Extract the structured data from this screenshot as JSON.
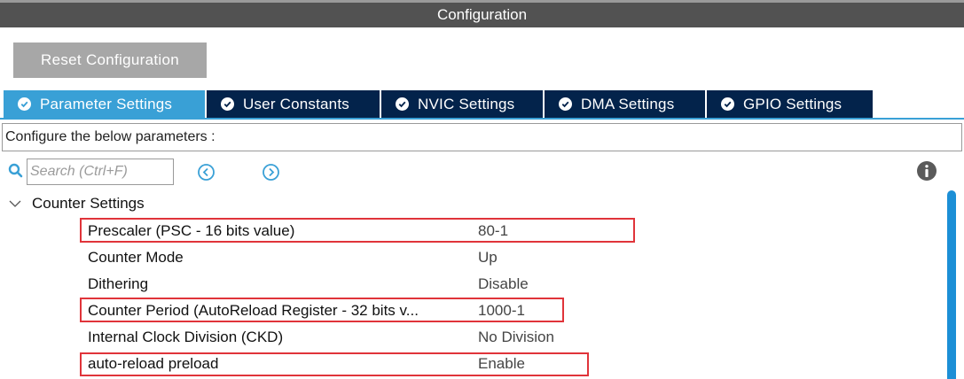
{
  "window": {
    "title": "Configuration"
  },
  "toolbar": {
    "reset_label": "Reset Configuration"
  },
  "tabs": [
    {
      "label": "Parameter Settings",
      "active": true
    },
    {
      "label": "User Constants",
      "active": false
    },
    {
      "label": "NVIC Settings",
      "active": false
    },
    {
      "label": "DMA Settings",
      "active": false
    },
    {
      "label": "GPIO Settings",
      "active": false
    }
  ],
  "configure_text": "Configure the below parameters :",
  "search": {
    "placeholder": "Search (Ctrl+F)",
    "value": ""
  },
  "group": {
    "label": "Counter Settings",
    "rows": [
      {
        "name": "Prescaler (PSC - 16 bits value)",
        "value": "80-1",
        "highlighted": true
      },
      {
        "name": "Counter Mode",
        "value": "Up",
        "highlighted": false
      },
      {
        "name": "Dithering",
        "value": "Disable",
        "highlighted": false
      },
      {
        "name": "Counter Period (AutoReload Register - 32 bits v...",
        "value": "1000-1",
        "highlighted": true
      },
      {
        "name": "Internal Clock Division (CKD)",
        "value": "No Division",
        "highlighted": false
      },
      {
        "name": "auto-reload preload",
        "value": "Enable",
        "highlighted": true
      }
    ]
  },
  "colors": {
    "title_bar": "#525252",
    "tab_active": "#39a0d6",
    "tab_inactive": "#03234b",
    "highlight_border": "#e0343a",
    "accent_icon": "#39a0d6"
  }
}
